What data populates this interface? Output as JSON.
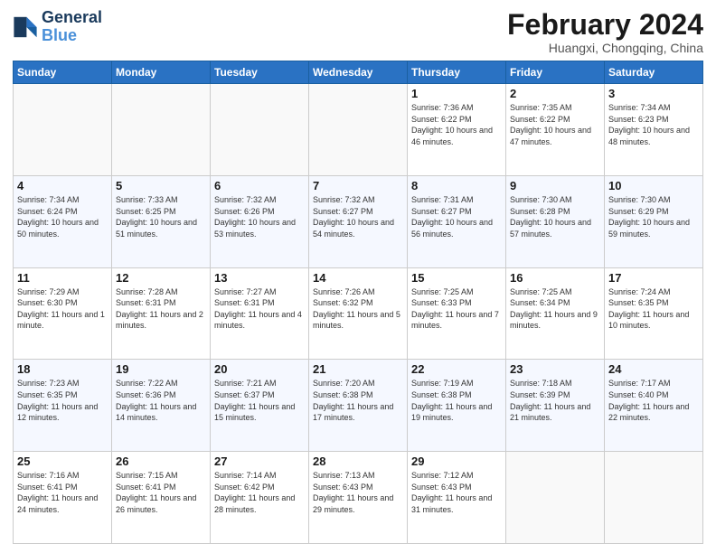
{
  "header": {
    "logo_line1": "General",
    "logo_line2": "Blue",
    "month": "February 2024",
    "location": "Huangxi, Chongqing, China"
  },
  "weekdays": [
    "Sunday",
    "Monday",
    "Tuesday",
    "Wednesday",
    "Thursday",
    "Friday",
    "Saturday"
  ],
  "weeks": [
    [
      {
        "day": "",
        "info": ""
      },
      {
        "day": "",
        "info": ""
      },
      {
        "day": "",
        "info": ""
      },
      {
        "day": "",
        "info": ""
      },
      {
        "day": "1",
        "info": "Sunrise: 7:36 AM\nSunset: 6:22 PM\nDaylight: 10 hours and 46 minutes."
      },
      {
        "day": "2",
        "info": "Sunrise: 7:35 AM\nSunset: 6:22 PM\nDaylight: 10 hours and 47 minutes."
      },
      {
        "day": "3",
        "info": "Sunrise: 7:34 AM\nSunset: 6:23 PM\nDaylight: 10 hours and 48 minutes."
      }
    ],
    [
      {
        "day": "4",
        "info": "Sunrise: 7:34 AM\nSunset: 6:24 PM\nDaylight: 10 hours and 50 minutes."
      },
      {
        "day": "5",
        "info": "Sunrise: 7:33 AM\nSunset: 6:25 PM\nDaylight: 10 hours and 51 minutes."
      },
      {
        "day": "6",
        "info": "Sunrise: 7:32 AM\nSunset: 6:26 PM\nDaylight: 10 hours and 53 minutes."
      },
      {
        "day": "7",
        "info": "Sunrise: 7:32 AM\nSunset: 6:27 PM\nDaylight: 10 hours and 54 minutes."
      },
      {
        "day": "8",
        "info": "Sunrise: 7:31 AM\nSunset: 6:27 PM\nDaylight: 10 hours and 56 minutes."
      },
      {
        "day": "9",
        "info": "Sunrise: 7:30 AM\nSunset: 6:28 PM\nDaylight: 10 hours and 57 minutes."
      },
      {
        "day": "10",
        "info": "Sunrise: 7:30 AM\nSunset: 6:29 PM\nDaylight: 10 hours and 59 minutes."
      }
    ],
    [
      {
        "day": "11",
        "info": "Sunrise: 7:29 AM\nSunset: 6:30 PM\nDaylight: 11 hours and 1 minute."
      },
      {
        "day": "12",
        "info": "Sunrise: 7:28 AM\nSunset: 6:31 PM\nDaylight: 11 hours and 2 minutes."
      },
      {
        "day": "13",
        "info": "Sunrise: 7:27 AM\nSunset: 6:31 PM\nDaylight: 11 hours and 4 minutes."
      },
      {
        "day": "14",
        "info": "Sunrise: 7:26 AM\nSunset: 6:32 PM\nDaylight: 11 hours and 5 minutes."
      },
      {
        "day": "15",
        "info": "Sunrise: 7:25 AM\nSunset: 6:33 PM\nDaylight: 11 hours and 7 minutes."
      },
      {
        "day": "16",
        "info": "Sunrise: 7:25 AM\nSunset: 6:34 PM\nDaylight: 11 hours and 9 minutes."
      },
      {
        "day": "17",
        "info": "Sunrise: 7:24 AM\nSunset: 6:35 PM\nDaylight: 11 hours and 10 minutes."
      }
    ],
    [
      {
        "day": "18",
        "info": "Sunrise: 7:23 AM\nSunset: 6:35 PM\nDaylight: 11 hours and 12 minutes."
      },
      {
        "day": "19",
        "info": "Sunrise: 7:22 AM\nSunset: 6:36 PM\nDaylight: 11 hours and 14 minutes."
      },
      {
        "day": "20",
        "info": "Sunrise: 7:21 AM\nSunset: 6:37 PM\nDaylight: 11 hours and 15 minutes."
      },
      {
        "day": "21",
        "info": "Sunrise: 7:20 AM\nSunset: 6:38 PM\nDaylight: 11 hours and 17 minutes."
      },
      {
        "day": "22",
        "info": "Sunrise: 7:19 AM\nSunset: 6:38 PM\nDaylight: 11 hours and 19 minutes."
      },
      {
        "day": "23",
        "info": "Sunrise: 7:18 AM\nSunset: 6:39 PM\nDaylight: 11 hours and 21 minutes."
      },
      {
        "day": "24",
        "info": "Sunrise: 7:17 AM\nSunset: 6:40 PM\nDaylight: 11 hours and 22 minutes."
      }
    ],
    [
      {
        "day": "25",
        "info": "Sunrise: 7:16 AM\nSunset: 6:41 PM\nDaylight: 11 hours and 24 minutes."
      },
      {
        "day": "26",
        "info": "Sunrise: 7:15 AM\nSunset: 6:41 PM\nDaylight: 11 hours and 26 minutes."
      },
      {
        "day": "27",
        "info": "Sunrise: 7:14 AM\nSunset: 6:42 PM\nDaylight: 11 hours and 28 minutes."
      },
      {
        "day": "28",
        "info": "Sunrise: 7:13 AM\nSunset: 6:43 PM\nDaylight: 11 hours and 29 minutes."
      },
      {
        "day": "29",
        "info": "Sunrise: 7:12 AM\nSunset: 6:43 PM\nDaylight: 11 hours and 31 minutes."
      },
      {
        "day": "",
        "info": ""
      },
      {
        "day": "",
        "info": ""
      }
    ]
  ]
}
